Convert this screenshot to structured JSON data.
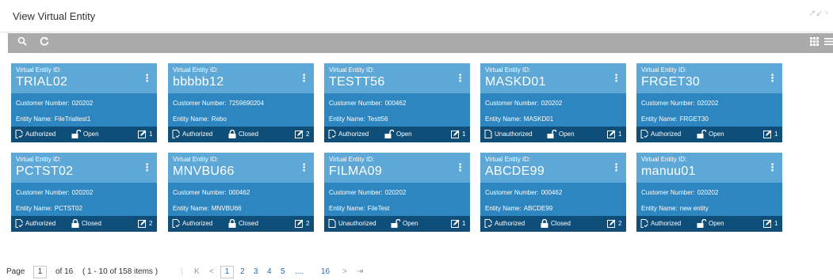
{
  "window": {
    "title": "View Virtual Entity",
    "minimize_icon": "collapse-icon",
    "close_icon": "close-icon"
  },
  "toolbar": {
    "search_icon": "search-icon",
    "refresh_icon": "refresh-icon",
    "grid_view_icon": "grid-view-icon",
    "list_view_icon": "list-view-icon"
  },
  "card_label": "Virtual Entity ID:",
  "customer_number_label": "Customer Number:",
  "entity_name_label": "Entity Name:",
  "cards": [
    {
      "id": "TRIAL02",
      "customer_number": "020202",
      "entity_name": "FileTrialtest1",
      "status": "Authorized",
      "lock": "Open",
      "count": "1"
    },
    {
      "id": "bbbbb12",
      "customer_number": "7259690204",
      "entity_name": "Rebo",
      "status": "Authorized",
      "lock": "Closed",
      "count": "2"
    },
    {
      "id": "TESTT56",
      "customer_number": "000462",
      "entity_name": "Testt56",
      "status": "Authorized",
      "lock": "Open",
      "count": "1"
    },
    {
      "id": "MASKD01",
      "customer_number": "020202",
      "entity_name": "MASKD01",
      "status": "Unauthorized",
      "lock": "Open",
      "count": "1"
    },
    {
      "id": "FRGET30",
      "customer_number": "020202",
      "entity_name": "FRGET30",
      "status": "Authorized",
      "lock": "Open",
      "count": "1"
    },
    {
      "id": "PCTST02",
      "customer_number": "020202",
      "entity_name": "PCTST02",
      "status": "Authorized",
      "lock": "Closed",
      "count": "2"
    },
    {
      "id": "MNVBU66",
      "customer_number": "000462",
      "entity_name": "MNVBU66",
      "status": "Authorized",
      "lock": "Closed",
      "count": "2"
    },
    {
      "id": "FILMA09",
      "customer_number": "020202",
      "entity_name": "FileTest",
      "status": "Unauthorized",
      "lock": "Open",
      "count": "1"
    },
    {
      "id": "ABCDE99",
      "customer_number": "000462",
      "entity_name": "ABCDE99",
      "status": "Authorized",
      "lock": "Closed",
      "count": "2"
    },
    {
      "id": "manuu01",
      "customer_number": "020202",
      "entity_name": "new entity",
      "status": "Authorized",
      "lock": "Open",
      "count": "1"
    }
  ],
  "pagination": {
    "page_label": "Page",
    "current_page": "1",
    "of_total": "of 16",
    "items_info": "( 1 - 10 of 158 items )",
    "first": "K",
    "prev": "<",
    "pages": [
      "1",
      "2",
      "3",
      "4",
      "5"
    ],
    "ellipsis": "....",
    "last_page": "16",
    "next": ">",
    "last": "⊳|"
  },
  "colors": {
    "card_header": "#5ea8d8",
    "card_body": "#2e86c1",
    "card_footer": "#0e4e78",
    "toolbar": "#aaaaaa"
  }
}
